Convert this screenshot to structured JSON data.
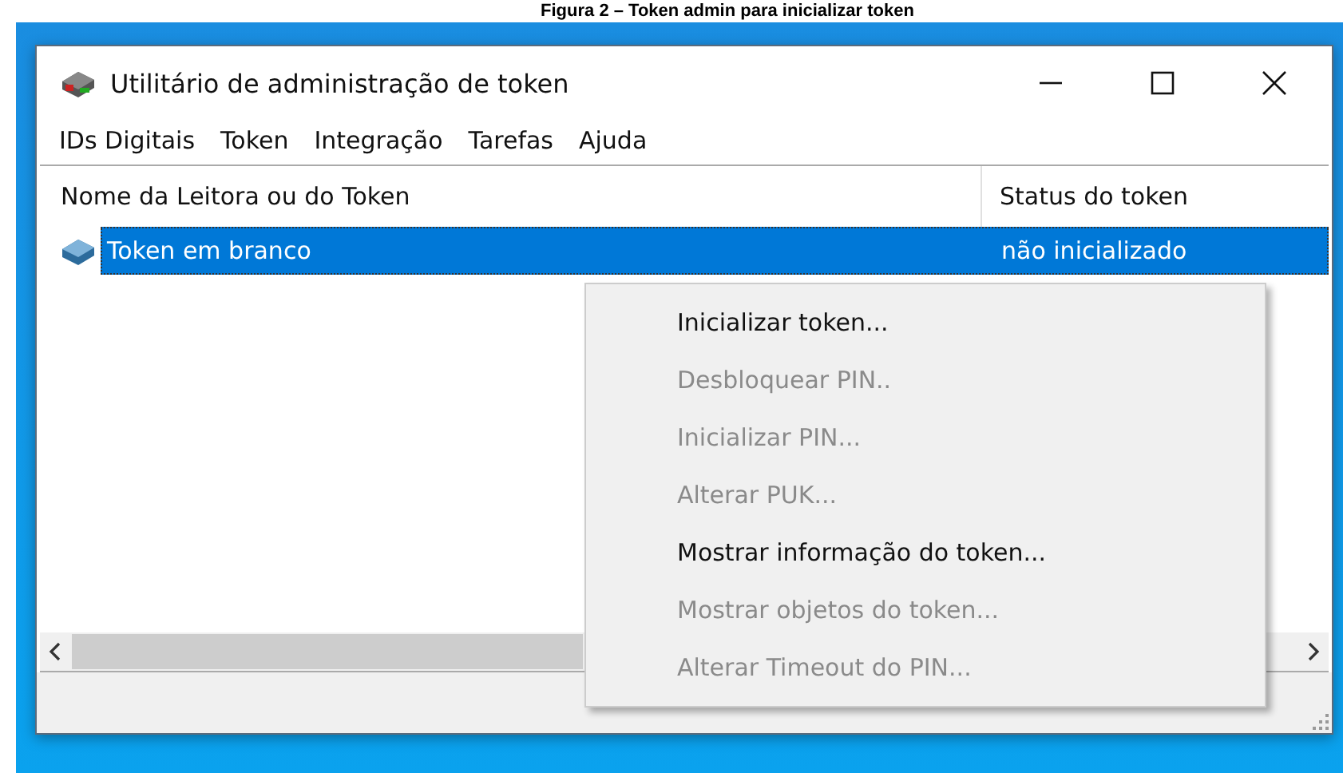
{
  "caption": "Figura 2 – Token admin para inicializar token",
  "window": {
    "title": "Utilitário de administração de token"
  },
  "menu": [
    "IDs Digitais",
    "Token",
    "Integração",
    "Tarefas",
    "Ajuda"
  ],
  "table": {
    "columns": [
      "Nome da Leitora ou do Token",
      "Status do token"
    ],
    "rows": [
      {
        "name": "Token em branco",
        "status": "não inicializado",
        "selected": true
      }
    ]
  },
  "context_menu": [
    {
      "label": "Inicializar token...",
      "disabled": false
    },
    {
      "label": "Desbloquear PIN..",
      "disabled": true
    },
    {
      "label": "Inicializar PIN...",
      "disabled": true
    },
    {
      "label": "Alterar PUK...",
      "disabled": true
    },
    {
      "label": "Mostrar informação do token...",
      "disabled": false
    },
    {
      "label": "Mostrar objetos do token...",
      "disabled": true
    },
    {
      "label": "Alterar Timeout do PIN...",
      "disabled": true
    }
  ]
}
